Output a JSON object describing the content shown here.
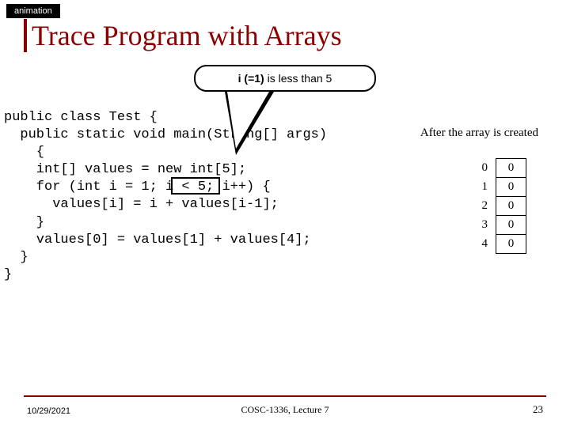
{
  "tag": "animation",
  "title": "Trace Program with Arrays",
  "callout": {
    "prefix": "i (=1)",
    "mid": " is less than ",
    "suffix": "5"
  },
  "code": "public class Test {\n  public static void main(String[] args) \n    {\n    int[] values = new int[5];\n    for (int i = 1; i < 5; i++) {\n      values[i] = i + values[i-1];\n    }\n    values[0] = values[1] + values[4];\n  }\n}",
  "after_label": "After the array is created",
  "array": {
    "indices": [
      "0",
      "1",
      "2",
      "3",
      "4"
    ],
    "values": [
      "0",
      "0",
      "0",
      "0",
      "0"
    ]
  },
  "footer": {
    "date": "10/29/2021",
    "center": "COSC-1336, Lecture 7",
    "page": "23"
  }
}
